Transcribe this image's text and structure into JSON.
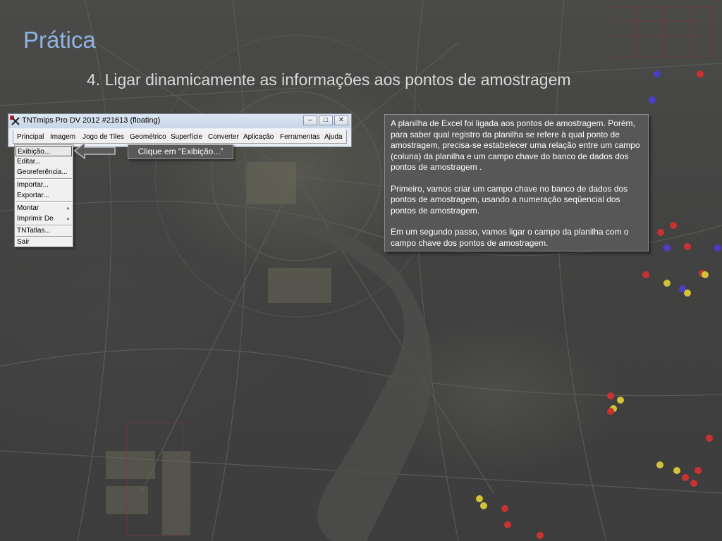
{
  "slide": {
    "title": "Prática",
    "subtitle": "4. Ligar dinamicamente as informações aos pontos de amostragem"
  },
  "window": {
    "title": "TNTmips Pro DV 2012  #21613 (floating)",
    "controls": {
      "minimize": "‒",
      "maximize": "□",
      "close": "✕"
    },
    "menu": [
      "Principal",
      "Imagem",
      "Jogo de Tiles",
      "Geométrico",
      "Superfície",
      "Converter",
      "Aplicação",
      "Ferramentas",
      "Ajuda"
    ]
  },
  "dropdown": {
    "items": [
      {
        "label": "Exibição...",
        "selected": true
      },
      {
        "label": "Editar..."
      },
      {
        "label": "Georeferência..."
      },
      {
        "label": "Importar..."
      },
      {
        "label": "Exportar..."
      },
      {
        "label": "Montar",
        "submenu": true
      },
      {
        "label": "Imprimir De",
        "submenu": true
      },
      {
        "label": "TNTatlas..."
      },
      {
        "label": "Sair"
      }
    ]
  },
  "callout": {
    "label": "Clique em “Exibição...”"
  },
  "info": {
    "paragraphs": [
      "A planilha de Excel foi ligada aos pontos de amostragem. Porém, para saber qual registro da planilha se refere à qual ponto de amostragem, precisa-se estabelecer  uma relação entre um campo (coluna) da planilha e um campo chave do banco de dados dos pontos de amostragem .",
      "Primeiro, vamos criar um campo chave no banco de dados dos pontos de amostragem, usando a numeração seqüencial dos pontos de amostragem.",
      "Em um segundo passo, vamos ligar o campo da planilha com o campo chave dos pontos de amostragem."
    ]
  },
  "colors": {
    "title": "#8fb4e3",
    "subtitle": "#d9d9d9",
    "box_bg": "#575757",
    "dot_red": "#c83232",
    "dot_yellow": "#d2c23a",
    "dot_purple": "#4a3ec8"
  }
}
